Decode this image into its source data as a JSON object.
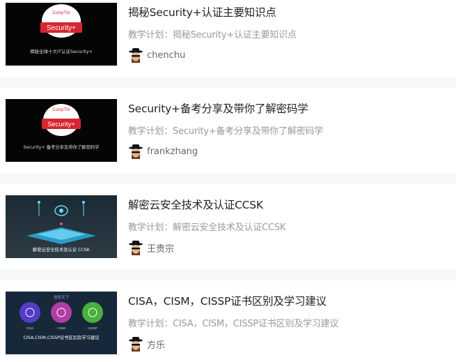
{
  "courses": [
    {
      "title": "揭秘Security+认证主要知识点",
      "plan_prefix": "教学计划：",
      "plan": "揭秘Security+认证主要知识点",
      "author": "chenchu",
      "thumb_logo_top": "CompTIA",
      "thumb_logo_mid": "Security+",
      "thumb_caption": "揭秘全球十大IT认证Security+",
      "thumb_icon": "security-plus-logo"
    },
    {
      "title": "Security+备考分享及带你了解密码学",
      "plan_prefix": "教学计划：",
      "plan": "Security+备考分享及带你了解密码学",
      "author": "frankzhang",
      "thumb_logo_top": "CompTIA",
      "thumb_logo_mid": "Security+",
      "thumb_caption": "Security+ 备考分享及带你了解密码学",
      "thumb_icon": "security-plus-logo"
    },
    {
      "title": "解密云安全技术及认证CCSK",
      "plan_prefix": "教学计划：",
      "plan": "解密云安全技术及认证CCSK",
      "author": "王贵宗",
      "thumb_caption": "解密云安全技术及认证 CCSK",
      "thumb_icon": "cloud-security-illustration"
    },
    {
      "title": "CISA，CISM，CISSP证书区别及学习建议",
      "plan_prefix": "教学计划：",
      "plan": "CISA，CISM，CISSP证书区别及学习建议",
      "author": "方乐",
      "thumb_header": "谷安天下",
      "thumb_labels": [
        "CISA",
        "CISM",
        "CISSP"
      ],
      "thumb_caption": "CISA,CISM,CISSP证书区别及学习建议",
      "thumb_icon": "three-certificates-illustration"
    }
  ],
  "colors": {
    "separator": "#f6f7f9",
    "title": "#222222",
    "plan": "#9a9a9a",
    "author": "#666666",
    "comptia_red": "#d7262f"
  }
}
